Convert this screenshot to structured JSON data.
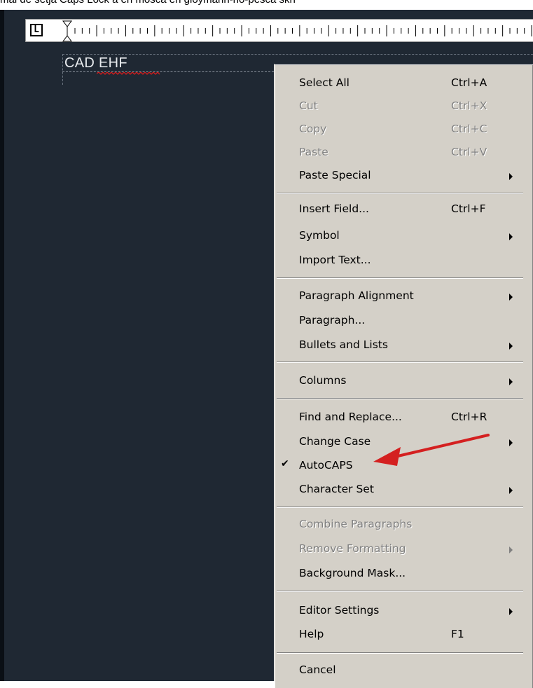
{
  "caption": "mai de setja Caps Lock a en mosca en gloymann-no-pesca skn",
  "ruler": {
    "tab_glyph": "L"
  },
  "editor": {
    "text": "CAD EHF"
  },
  "context_menu": {
    "items": [
      {
        "label": "Select All",
        "shortcut": "Ctrl+A"
      },
      {
        "label": "Cut",
        "shortcut": "Ctrl+X"
      },
      {
        "label": "Copy",
        "shortcut": "Ctrl+C"
      },
      {
        "label": "Paste",
        "shortcut": "Ctrl+V"
      },
      {
        "label": "Paste Special",
        "shortcut": ""
      },
      {
        "label": "Insert Field...",
        "shortcut": "Ctrl+F"
      },
      {
        "label": "Symbol",
        "shortcut": ""
      },
      {
        "label": "Import Text...",
        "shortcut": ""
      },
      {
        "label": "Paragraph Alignment",
        "shortcut": ""
      },
      {
        "label": "Paragraph...",
        "shortcut": ""
      },
      {
        "label": "Bullets and Lists",
        "shortcut": ""
      },
      {
        "label": "Columns",
        "shortcut": ""
      },
      {
        "label": "Find and Replace...",
        "shortcut": "Ctrl+R"
      },
      {
        "label": "Change Case",
        "shortcut": ""
      },
      {
        "label": "AutoCAPS",
        "shortcut": "",
        "checked": true
      },
      {
        "label": "Character Set",
        "shortcut": ""
      },
      {
        "label": "Combine Paragraphs",
        "shortcut": ""
      },
      {
        "label": "Remove Formatting",
        "shortcut": ""
      },
      {
        "label": "Background Mask...",
        "shortcut": ""
      },
      {
        "label": "Editor Settings",
        "shortcut": ""
      },
      {
        "label": "Help",
        "shortcut": "F1"
      },
      {
        "label": "Cancel",
        "shortcut": ""
      }
    ],
    "check_glyph": "✔"
  },
  "colors": {
    "canvas": "#1f2833",
    "menu_bg": "#d4d0c8",
    "disabled_text": "#808080",
    "annotation_arrow": "#d42020"
  }
}
